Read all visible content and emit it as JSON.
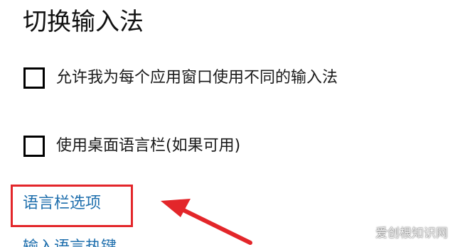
{
  "section": {
    "title": "切换输入法"
  },
  "options": {
    "per_app_window": {
      "label": "允许我为每个应用窗口使用不同的输入法",
      "checked": false
    },
    "desktop_language_bar": {
      "label": "使用桌面语言栏(如果可用)",
      "checked": false
    }
  },
  "links": {
    "language_bar_options": "语言栏选项",
    "input_language_hotkeys": "输入语言热键"
  },
  "annotation": {
    "highlight_color": "#e3262a",
    "link_color": "#1f6fad"
  },
  "watermark": {
    "text": "爱创根知识网"
  }
}
